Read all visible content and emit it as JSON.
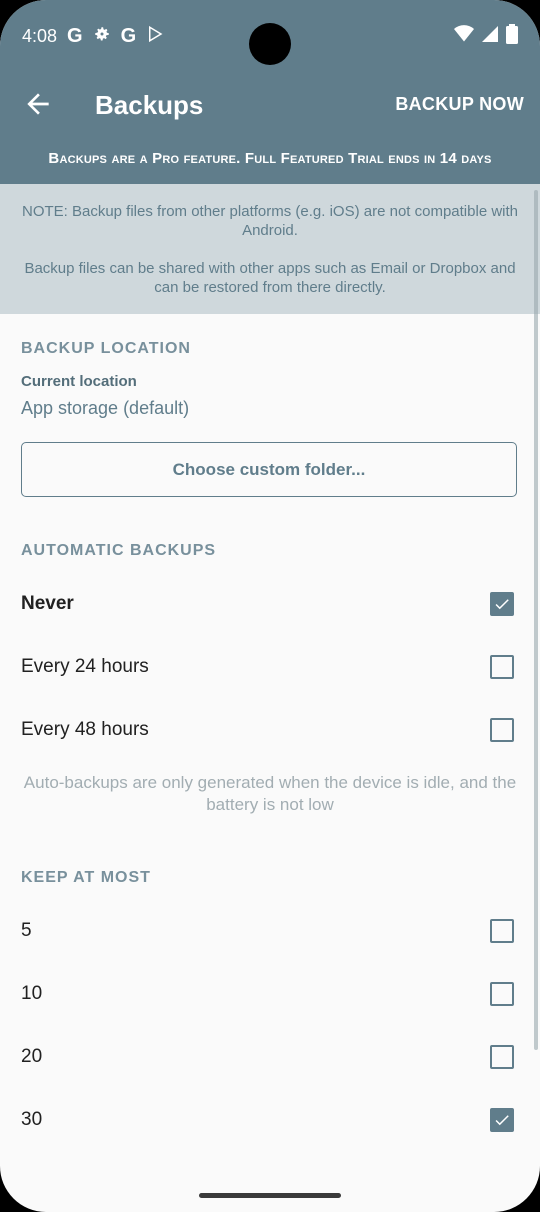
{
  "status_bar": {
    "time": "4:08",
    "left_icons": [
      "google-icon",
      "settings-icon",
      "google-icon",
      "play-store-icon"
    ],
    "right_icons": [
      "wifi-icon",
      "signal-icon",
      "battery-icon"
    ]
  },
  "app_bar": {
    "title": "Backups",
    "action": "BACKUP NOW",
    "back_icon": "arrow-back-icon",
    "color": "#607d8b"
  },
  "trial_banner": "Backups are a Pro feature. Full Featured Trial ends in 14 days",
  "note": {
    "line1": "NOTE: Backup files from other platforms (e.g. iOS) are not compatible with Android.",
    "line2": "Backup files can be shared with other apps such as Email or Dropbox and can be restored from there directly."
  },
  "backup_location": {
    "section_title": "BACKUP LOCATION",
    "current_label": "Current location",
    "current_value": "App storage (default)",
    "choose_button": "Choose custom folder..."
  },
  "automatic_backups": {
    "section_title": "AUTOMATIC BACKUPS",
    "options": [
      {
        "label": "Never",
        "checked": true
      },
      {
        "label": "Every 24 hours",
        "checked": false
      },
      {
        "label": "Every 48 hours",
        "checked": false
      }
    ],
    "hint": "Auto-backups are only generated when the device is idle, and the battery is not low"
  },
  "keep_at_most": {
    "section_title": "KEEP AT MOST",
    "options": [
      {
        "label": "5",
        "checked": false
      },
      {
        "label": "10",
        "checked": false
      },
      {
        "label": "20",
        "checked": false
      },
      {
        "label": "30",
        "checked": true
      }
    ]
  },
  "accent_color": "#607d8b"
}
